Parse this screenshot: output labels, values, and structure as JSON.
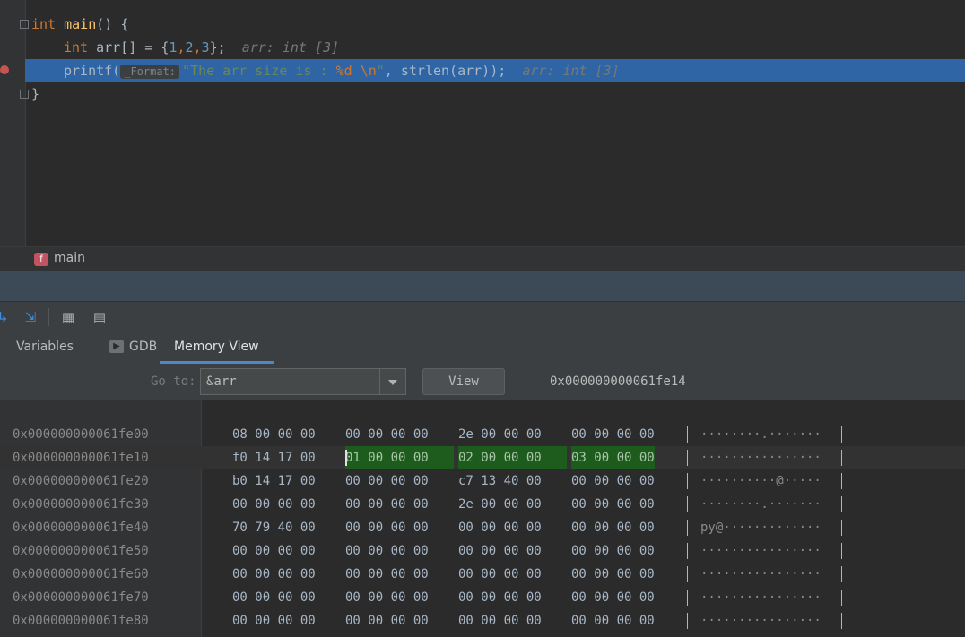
{
  "editor": {
    "line1": {
      "kw": "int",
      "fn": "main",
      "rest": "() {"
    },
    "line2": {
      "kw": "int",
      "decl": " arr[] = {",
      "n1": "1",
      "n2": "2",
      "n3": "3",
      "close": "};",
      "hint": "arr: int [3]"
    },
    "line3": {
      "fn": "printf(",
      "inlay": "_Format:",
      "str1": "\"The arr size is : ",
      "fmt": "%d",
      "sp": " ",
      "esc": "\\n",
      "str2": "\"",
      "rest": ", strlen(arr));",
      "hint": "arr: int [3]"
    },
    "line4": "}"
  },
  "breadcrumb": {
    "badge": "f",
    "label": "main"
  },
  "tabs": [
    {
      "label": "Variables"
    },
    {
      "label": "GDB"
    },
    {
      "label": "Memory View"
    }
  ],
  "goto": {
    "label": "Go to:",
    "value": "&arr",
    "view_button": "View",
    "address": "0x000000000061fe14"
  },
  "memory": [
    {
      "addr": "0x000000000061fe00",
      "g": [
        "08 00 00 00",
        "00 00 00 00",
        "2e 00 00 00",
        "00 00 00 00"
      ],
      "ascii": "········.·······"
    },
    {
      "addr": "0x000000000061fe10",
      "g": [
        "f0 14 17 00",
        "01 00 00 00",
        "02 00 00 00",
        "03 00 00 00"
      ],
      "ascii": "················"
    },
    {
      "addr": "0x000000000061fe20",
      "g": [
        "b0 14 17 00",
        "00 00 00 00",
        "c7 13 40 00",
        "00 00 00 00"
      ],
      "ascii": "··········@·····"
    },
    {
      "addr": "0x000000000061fe30",
      "g": [
        "00 00 00 00",
        "00 00 00 00",
        "2e 00 00 00",
        "00 00 00 00"
      ],
      "ascii": "········.·······"
    },
    {
      "addr": "0x000000000061fe40",
      "g": [
        "70 79 40 00",
        "00 00 00 00",
        "00 00 00 00",
        "00 00 00 00"
      ],
      "ascii": "py@·············"
    },
    {
      "addr": "0x000000000061fe50",
      "g": [
        "00 00 00 00",
        "00 00 00 00",
        "00 00 00 00",
        "00 00 00 00"
      ],
      "ascii": "················"
    },
    {
      "addr": "0x000000000061fe60",
      "g": [
        "00 00 00 00",
        "00 00 00 00",
        "00 00 00 00",
        "00 00 00 00"
      ],
      "ascii": "················"
    },
    {
      "addr": "0x000000000061fe70",
      "g": [
        "00 00 00 00",
        "00 00 00 00",
        "00 00 00 00",
        "00 00 00 00"
      ],
      "ascii": "················"
    },
    {
      "addr": "0x000000000061fe80",
      "g": [
        "00 00 00 00",
        "00 00 00 00",
        "00 00 00 00",
        "00 00 00 00"
      ],
      "ascii": "················"
    }
  ],
  "colors": {
    "accent": "#2f65a5",
    "highlight_bytes": "#1e5c1e",
    "tab_underline": "#4a88c7"
  },
  "icons": [
    "step-over-icon",
    "force-step-into-icon",
    "evaluate-table-icon",
    "layout-icon",
    "breakpoint-icon",
    "gdb-icon"
  ]
}
